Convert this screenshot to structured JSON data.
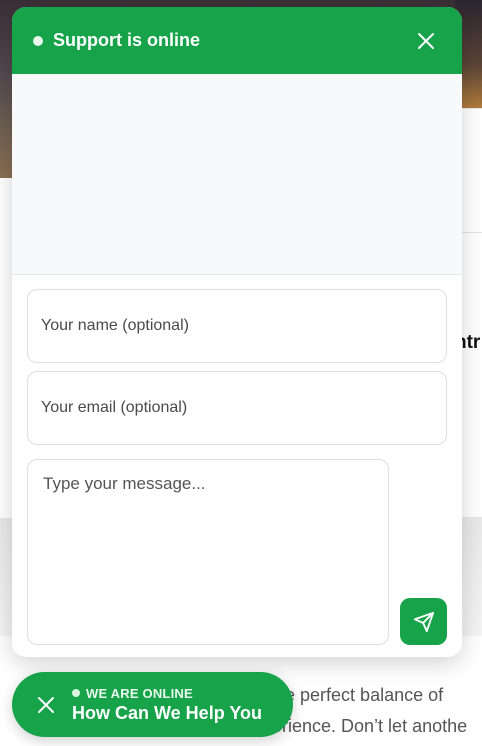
{
  "background": {
    "card_text": "ntr",
    "paragraph_lines": [
      "the perfect balance of",
      "erience. Don’t let anothe"
    ]
  },
  "chat": {
    "header": {
      "title": "Support is online",
      "close_icon": "close-icon"
    },
    "form": {
      "name_placeholder": "Your name (optional)",
      "name_value": "",
      "email_placeholder": "Your email (optional)",
      "email_value": "",
      "message_placeholder": "Type your message...",
      "message_value": "",
      "send_icon": "send-icon"
    }
  },
  "launcher": {
    "status": "WE ARE ONLINE",
    "title": "How Can We Help You",
    "close_icon": "close-icon"
  },
  "colors": {
    "brand_green": "#17a34a",
    "panel_bg": "#f8f9fb",
    "field_border": "#dcdfe3"
  }
}
